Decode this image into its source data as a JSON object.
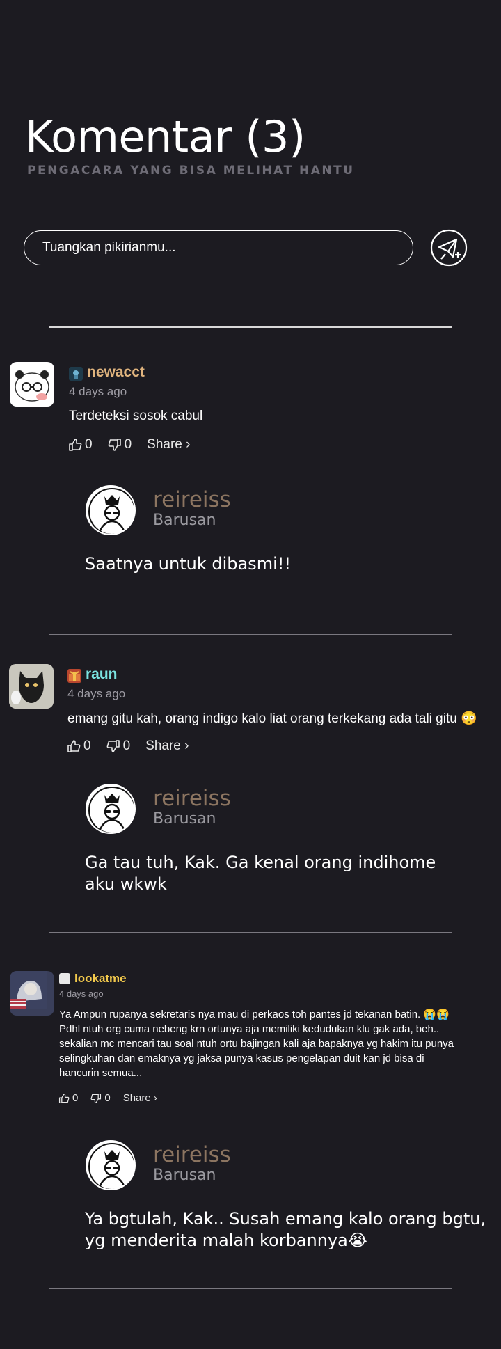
{
  "header": {
    "title": "Komentar (3)",
    "subtitle": "PENGACARA YANG BISA MELIHAT HANTU"
  },
  "composer": {
    "placeholder": "Tuangkan pikirianmu..."
  },
  "comments": [
    {
      "username": "newacct",
      "username_color": "#e0b47e",
      "time": "4 days ago",
      "text": "Terdeteksi sosok cabul",
      "likes": "0",
      "dislikes": "0",
      "share": "Share ›",
      "reply": {
        "username": "reireiss",
        "time": "Barusan",
        "text": "Saatnya untuk dibasmi!!"
      }
    },
    {
      "username": "raun",
      "username_color": "#7be3e0",
      "time": "4 days ago",
      "text": "emang gitu kah, orang indigo kalo liat orang terkekang ada tali gitu 😳",
      "likes": "0",
      "dislikes": "0",
      "share": "Share ›",
      "reply": {
        "username": "reireiss",
        "time": "Barusan",
        "text_line1": "Ga tau tuh, Kak. Ga kenal orang indihome",
        "text_line2": "aku wkwk"
      }
    },
    {
      "username": "lookatme",
      "username_color": "#f2c94c",
      "time": "4 days ago",
      "text_lines": [
        "Ya Ampun rupanya sekretaris nya mau di perkaos toh pantes jd tekanan batin. 😭😭",
        "Pdhl ntuh org cuma nebeng krn ortunya aja memiliki kedudukan klu gak ada, beh..",
        "sekalian mc mencari tau soal ntuh ortu bajingan kali aja bapaknya yg hakim itu punya",
        "selingkuhan dan emaknya yg jaksa punya kasus pengelapan duit kan jd bisa di",
        "hancurin semua..."
      ],
      "likes": "0",
      "dislikes": "0",
      "share": "Share ›",
      "reply": {
        "username": "reireiss",
        "time": "Barusan",
        "text_line1": "Ya bgtulah, Kak.. Susah emang kalo orang bgtu,",
        "text_line2": "yg menderita malah korbannya😭"
      }
    }
  ]
}
